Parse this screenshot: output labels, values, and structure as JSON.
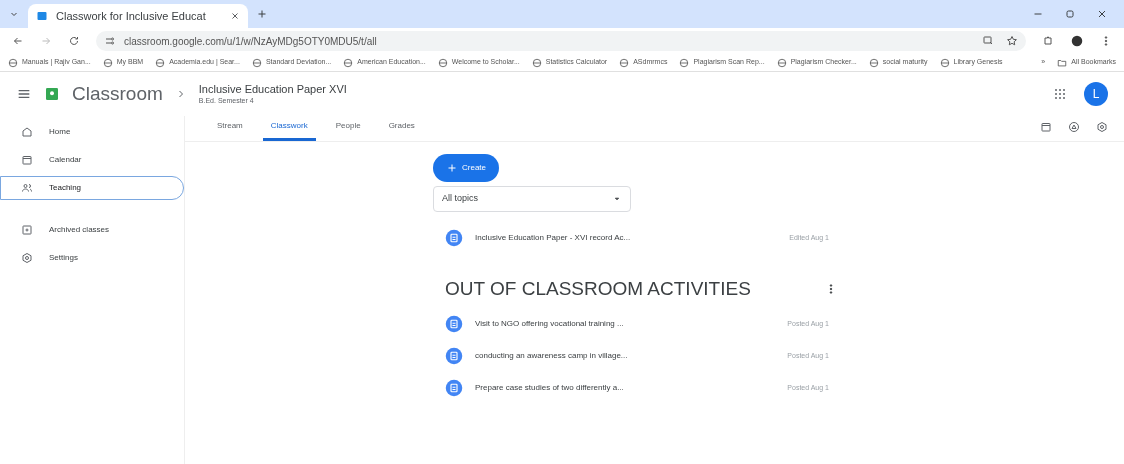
{
  "browser": {
    "tabs": [
      {
        "label": "Classwork for Inclusive Educat",
        "selected": true
      }
    ],
    "url": "classroom.google.com/u/1/w/NzAyMDg5OTY0MDU5/t/all"
  },
  "bookmarks": [
    "Manuals | Rajiv Gan...",
    "My BBM",
    "Academia.edu | Sear...",
    "Standard Deviation...",
    "American Education...",
    "Welcome to Scholar...",
    "Statistics Calculator",
    "ASdmrmcs",
    "Plagiarism Scan Rep...",
    "Plagiarism Checker...",
    "social maturity",
    "Library Genesis"
  ],
  "bookmarks_more": "»",
  "all_bookmarks": "All Bookmarks",
  "app": {
    "name": "Classroom",
    "class_title": "Inclusive Education Paper XVI",
    "class_subtitle": "B.Ed. Semester 4",
    "avatar": "L"
  },
  "sidebar": {
    "items": [
      {
        "label": "Home",
        "selected": false
      },
      {
        "label": "Calendar",
        "selected": false
      },
      {
        "label": "Teaching",
        "selected": true
      },
      {
        "label": "Archived classes",
        "selected": false
      },
      {
        "label": "Settings",
        "selected": false
      }
    ]
  },
  "class_tabs": [
    {
      "label": "Stream",
      "selected": false
    },
    {
      "label": "Classwork",
      "selected": true
    },
    {
      "label": "People",
      "selected": false
    },
    {
      "label": "Grades",
      "selected": false
    }
  ],
  "create_button": "Create",
  "topic_filter": "All topics",
  "items": [
    {
      "title": "Inclusive Education Paper - XVI record Ac...",
      "date": "Edited Aug 1"
    }
  ],
  "topics": [
    {
      "title": "OUT OF CLASSROOM ACTIVITIES",
      "items": [
        {
          "title": "Visit to NGO offering vocational training ...",
          "date": "Posted Aug 1"
        },
        {
          "title": "conducting an awareness camp in village...",
          "date": "Posted Aug 1"
        },
        {
          "title": "Prepare case studies of two differently a...",
          "date": "Posted Aug 1"
        }
      ]
    }
  ]
}
